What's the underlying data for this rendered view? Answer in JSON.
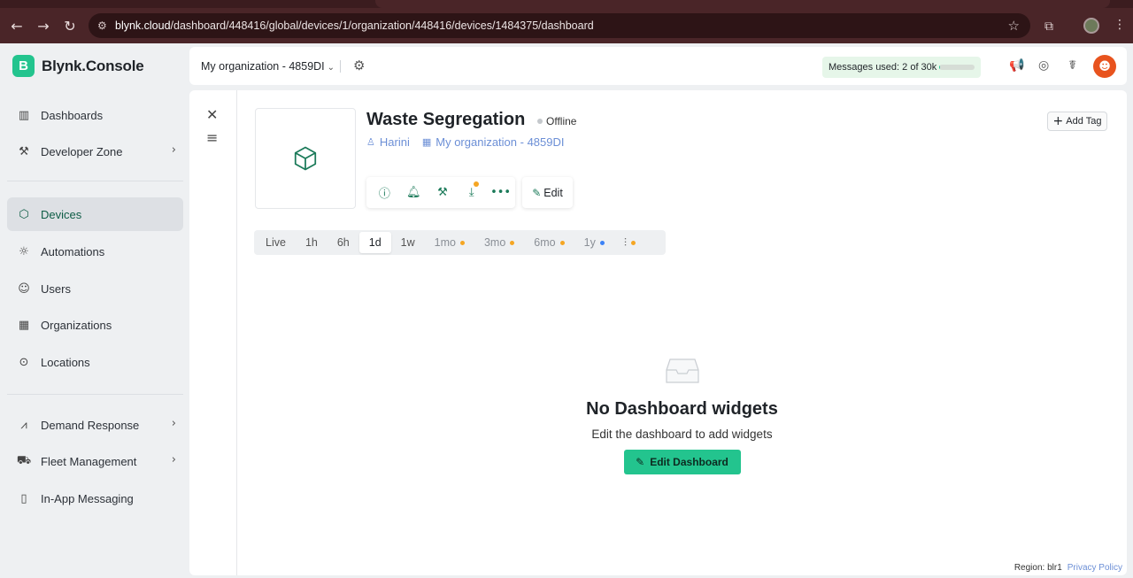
{
  "browser": {
    "url_host": "blynk.cloud",
    "url_path": "/dashboard/448416/global/devices/1/organization/448416/devices/1484375/dashboard",
    "back_icon": "arrow-left-icon",
    "forward_icon": "arrow-right-icon",
    "reload_icon": "reload-icon"
  },
  "brand": {
    "logo_letter": "B",
    "name": "Blynk.Console"
  },
  "sidebar": {
    "items": [
      {
        "label": "Dashboards",
        "icon": "chart-icon"
      },
      {
        "label": "Developer Zone",
        "icon": "tools-icon"
      },
      {
        "label": "Devices",
        "icon": "cube-icon"
      },
      {
        "label": "Automations",
        "icon": "automation-icon"
      },
      {
        "label": "Users",
        "icon": "users-icon"
      },
      {
        "label": "Organizations",
        "icon": "building-icon"
      },
      {
        "label": "Locations",
        "icon": "pin-icon"
      },
      {
        "label": "Demand Response",
        "icon": "signal-icon"
      },
      {
        "label": "Fleet Management",
        "icon": "truck-icon"
      },
      {
        "label": "In-App Messaging",
        "icon": "message-icon"
      }
    ]
  },
  "topbar": {
    "org_name": "My organization - 4859DI",
    "messages_label": "Messages used: 2 of 30k",
    "messages_used_fraction": 0.0001
  },
  "device": {
    "title": "Waste Segregation",
    "status": "Offline",
    "owner": "Harini",
    "organization": "My organization - 4859DI",
    "edit_label": "Edit",
    "add_tag_label": "Add Tag"
  },
  "ranges": {
    "items": [
      "Live",
      "1h",
      "6h",
      "1d",
      "1w",
      "1mo",
      "3mo",
      "6mo",
      "1y"
    ],
    "selected": "1d"
  },
  "empty_state": {
    "title": "No Dashboard widgets",
    "subtitle": "Edit the dashboard to add widgets",
    "button_label": "Edit Dashboard"
  },
  "footer": {
    "region": "Region: blr1",
    "privacy": "Privacy Policy"
  },
  "colors": {
    "accent": "#23c48e",
    "link": "#6c8fd6",
    "avatar": "#e8531e",
    "badge_orange": "#f5a623",
    "badge_blue": "#3b82f6"
  }
}
